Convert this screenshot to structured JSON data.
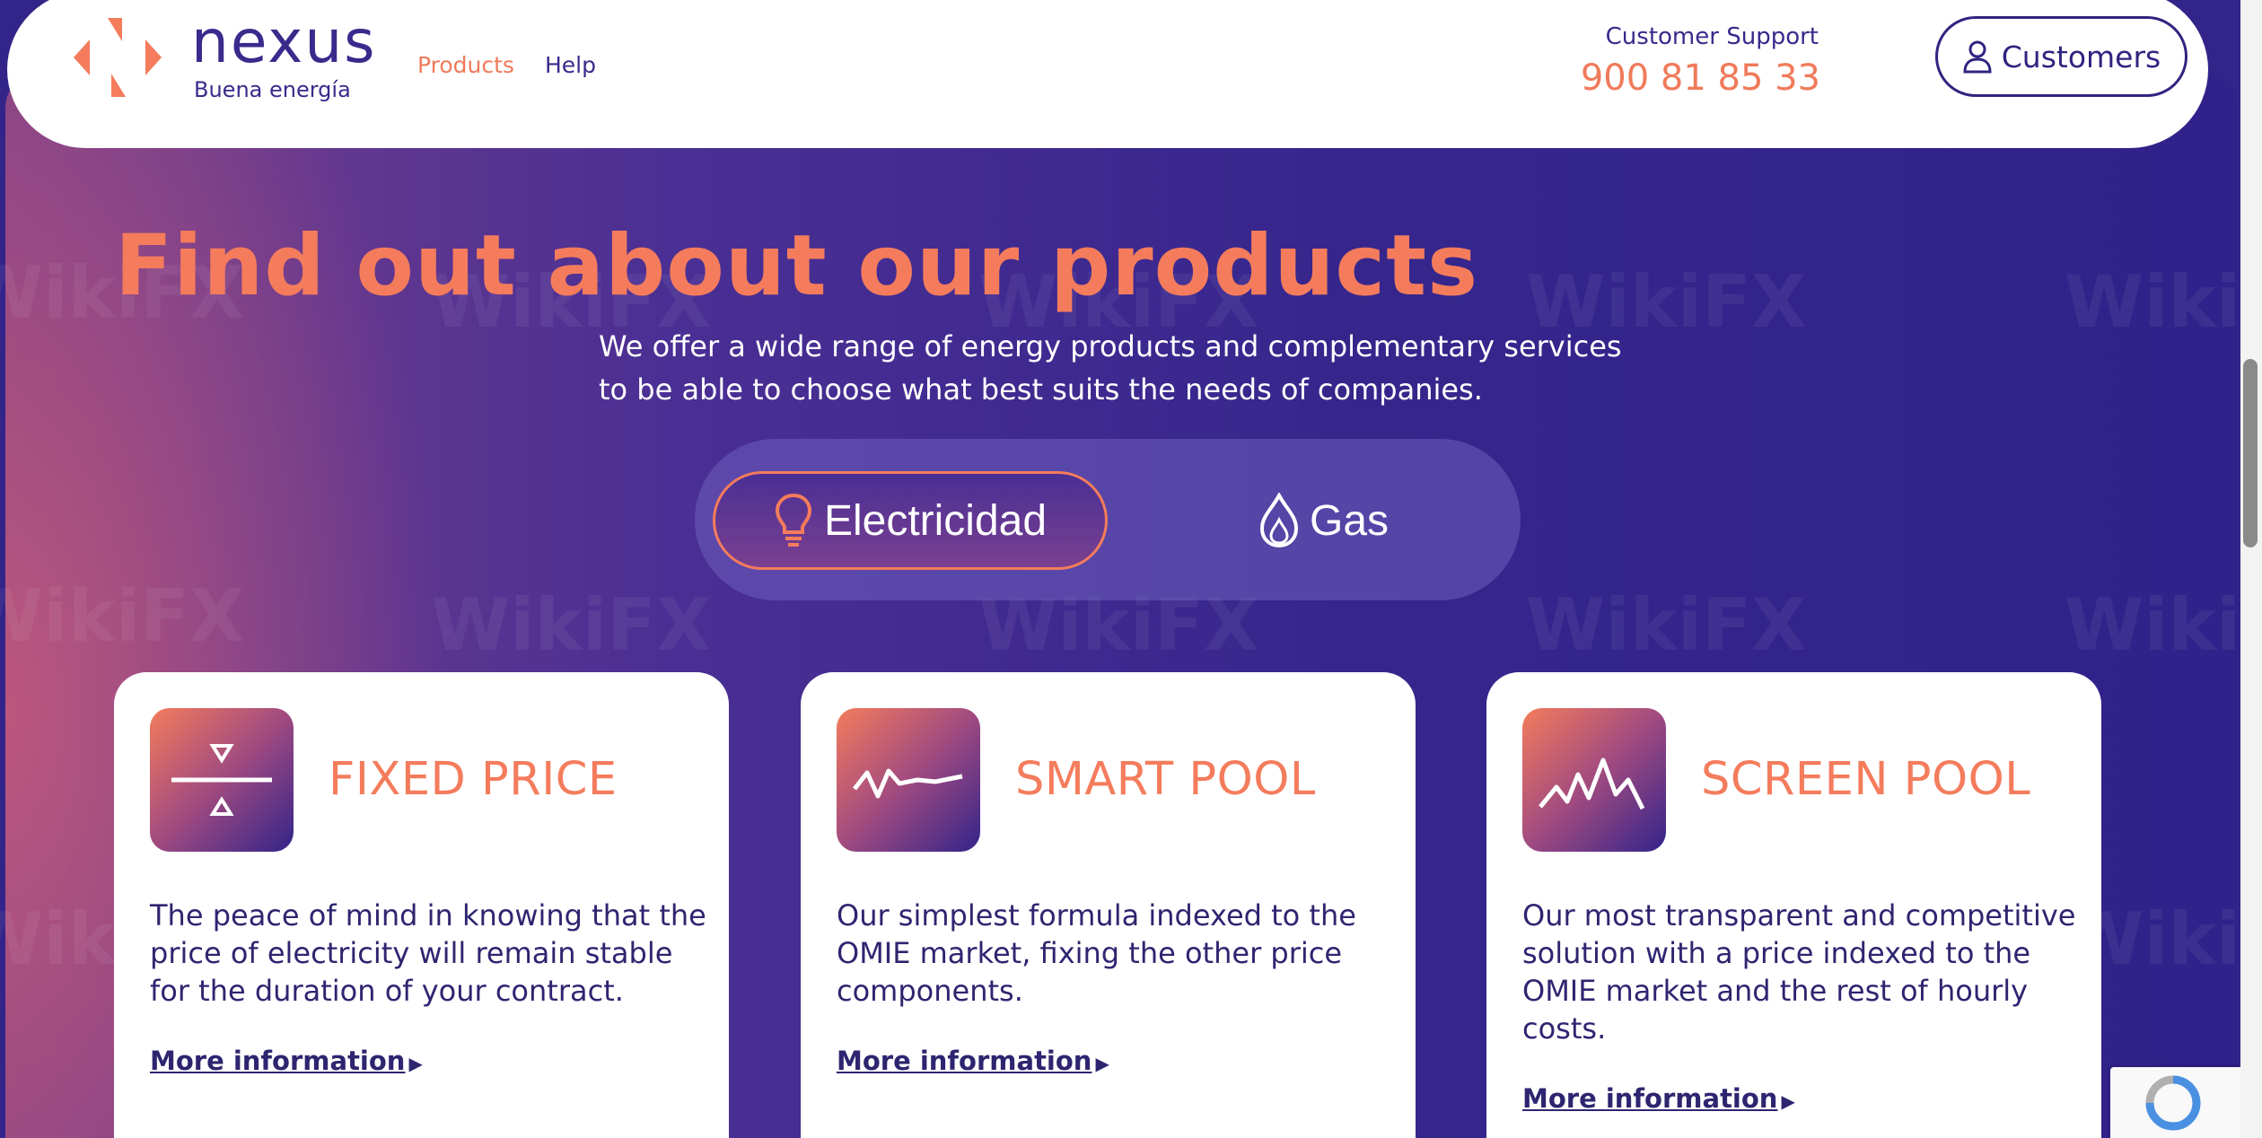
{
  "header": {
    "logo_text": "nexus",
    "logo_tagline": "Buena energía",
    "nav": [
      {
        "label": "Products",
        "active": true
      },
      {
        "label": "Help",
        "active": false
      }
    ],
    "support_label": "Customer Support",
    "support_phone": "900 81 85 33",
    "customers_label": "Customers"
  },
  "hero": {
    "title": "Find out about our products",
    "description": "We offer a wide range of energy products and complementary services to be able to choose what best suits the needs of companies.",
    "tabs": [
      {
        "label": "Electricidad",
        "icon": "lightbulb-icon",
        "selected": true
      },
      {
        "label": "Gas",
        "icon": "flame-icon",
        "selected": false
      }
    ]
  },
  "products": [
    {
      "title": "FIXED PRICE",
      "icon": "fixed-price-icon",
      "description": "The peace of mind in knowing that the price of electricity will remain stable for the duration of your contract.",
      "link": "More information"
    },
    {
      "title": "SMART POOL",
      "icon": "pulse-line-icon",
      "description": "Our simplest formula indexed to the OMIE market, fixing the other price components.",
      "link": "More information"
    },
    {
      "title": "SCREEN POOL",
      "icon": "zigzag-chart-icon",
      "description": "Our most transparent and competitive solution with a price indexed to the OMIE market and the rest of hourly costs.",
      "link": "More information"
    }
  ],
  "watermark": "WikiFX",
  "colors": {
    "brand_orange": "#f47c5c",
    "brand_purple": "#33248a"
  }
}
